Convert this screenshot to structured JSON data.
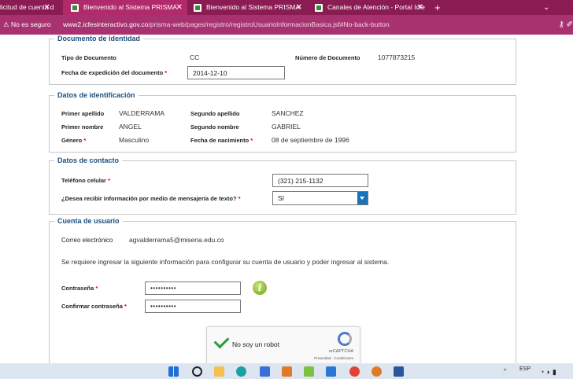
{
  "tabs": [
    {
      "label": "licitud de cuenta d",
      "active": false
    },
    {
      "label": "Bienvenido al Sistema PRISMA",
      "active": true
    },
    {
      "label": "Bienvenido al Sistema PRISMA",
      "active": false
    },
    {
      "label": "Canales de Atención - Portal Icfe",
      "active": false
    }
  ],
  "address": {
    "warning": "No es seguro",
    "host": "www2.icfesinteractivo.gov.co",
    "path": "/prisma-web/pages/registro/registroUsuarioInformacionBasica.jsf#No-back-button"
  },
  "documento": {
    "legend": "Documento de identidad",
    "tipo_label": "Tipo de Documento",
    "tipo_value": "CC",
    "numero_label": "Número de Documento",
    "numero_value": "1077873215",
    "fecha_label": "Fecha de expedición del documento",
    "fecha_value": "2014-12-10"
  },
  "identificacion": {
    "legend": "Datos de identificación",
    "primer_apellido_label": "Primer apellido",
    "primer_apellido_value": "VALDERRAMA",
    "segundo_apellido_label": "Segundo apellido",
    "segundo_apellido_value": "SANCHEZ",
    "primer_nombre_label": "Primer nombre",
    "primer_nombre_value": "ANGEL",
    "segundo_nombre_label": "Segundo nombre",
    "segundo_nombre_value": "GABRIEL",
    "genero_label": "Género",
    "genero_value": "Masculino",
    "nacimiento_label": "Fecha de nacimiento",
    "nacimiento_value": "08 de septiembre de 1996"
  },
  "contacto": {
    "legend": "Datos de contacto",
    "telefono_label": "Teléfono celular",
    "telefono_value": "(321) 215-1132",
    "mensajeria_label": "¿Desea recibir información por medio de mensajería de texto?",
    "mensajeria_value": "SI"
  },
  "cuenta": {
    "legend": "Cuenta de usuario",
    "correo_label": "Correo electrónico",
    "correo_value": "agvalderrama5@misena.edu.co",
    "instruccion": "Se requiere ingresar la siguiente información para configurar su cuenta de usuario y poder ingresar al sistema.",
    "contrasena_label": "Contraseña",
    "contrasena_value": "••••••••••",
    "confirmar_label": "Confirmar contraseña",
    "confirmar_value": "••••••••••"
  },
  "recaptcha": {
    "label": "No soy un robot",
    "brand": "reCAPTCHA",
    "links": "Privacidad - Condiciones"
  },
  "taskbar": {
    "lang": "ESP"
  },
  "required_mark": "*",
  "info_glyph": "i"
}
